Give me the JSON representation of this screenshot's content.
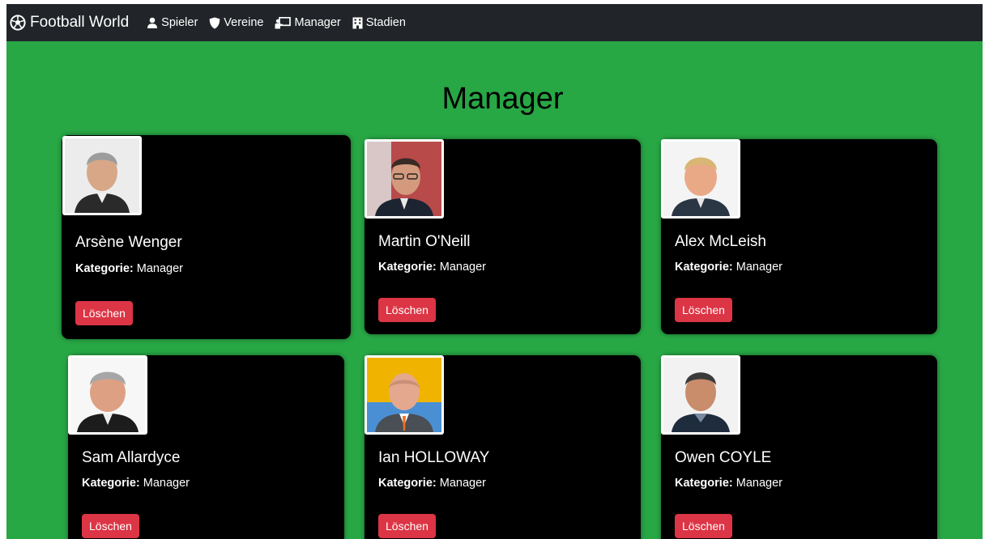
{
  "nav": {
    "brand": "Football World",
    "items": [
      {
        "label": "Spieler",
        "icon": "user-icon"
      },
      {
        "label": "Vereine",
        "icon": "shield-icon"
      },
      {
        "label": "Manager",
        "icon": "presentation-icon"
      },
      {
        "label": "Stadien",
        "icon": "building-icon"
      }
    ]
  },
  "page": {
    "title": "Manager"
  },
  "cards": [
    {
      "name": "Arsène Wenger",
      "category_label": "Kategorie:",
      "category_value": "Manager",
      "delete_label": "Löschen",
      "photo_bg": "#eeeeee"
    },
    {
      "name": "Martin O'Neill",
      "category_label": "Kategorie:",
      "category_value": "Manager",
      "delete_label": "Löschen",
      "photo_bg": "#b84a4a"
    },
    {
      "name": "Alex McLeish",
      "category_label": "Kategorie:",
      "category_value": "Manager",
      "delete_label": "Löschen",
      "photo_bg": "#f4f4f4"
    },
    {
      "name": "Sam Allardyce",
      "category_label": "Kategorie:",
      "category_value": "Manager",
      "delete_label": "Löschen",
      "photo_bg": "#f7f7f7"
    },
    {
      "name": "Ian HOLLOWAY",
      "category_label": "Kategorie:",
      "category_value": "Manager",
      "delete_label": "Löschen",
      "photo_bg": "#f0b400"
    },
    {
      "name": "Owen COYLE",
      "category_label": "Kategorie:",
      "category_value": "Manager",
      "delete_label": "Löschen",
      "photo_bg": "#f2f2f2"
    }
  ],
  "colors": {
    "navbar": "#212529",
    "background": "#28a745",
    "card": "#000000",
    "danger": "#dc3545"
  }
}
